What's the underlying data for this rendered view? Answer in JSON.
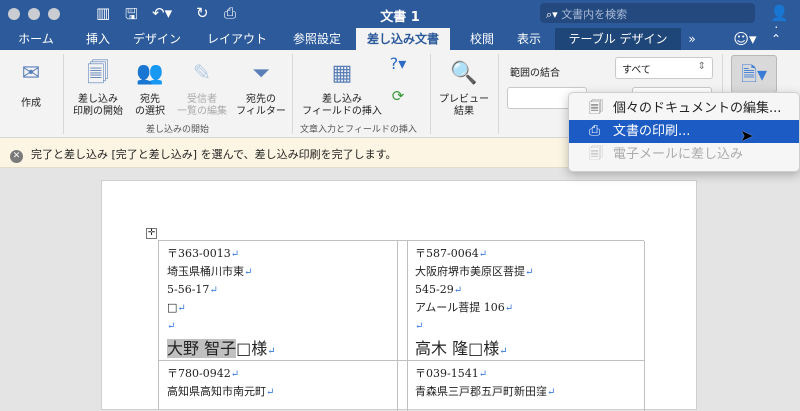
{
  "window": {
    "title": "文書 1",
    "search_placeholder": "文書内を検索"
  },
  "tabs": [
    "ホーム",
    "挿入",
    "デザイン",
    "レイアウト",
    "参照設定",
    "差し込み文書",
    "校閲",
    "表示",
    "テーブル デザイン"
  ],
  "ribbon": {
    "create": "作成",
    "start_merge": [
      "差し込み",
      "印刷の開始"
    ],
    "select_recipients": [
      "宛先",
      "の選択"
    ],
    "edit_recipients": [
      "受信者",
      "一覧の編集"
    ],
    "filter": [
      "宛先の",
      "フィルター"
    ],
    "insert_field": [
      "差し込み",
      "フィールドの挿入"
    ],
    "preview": [
      "プレビュー",
      "結果"
    ],
    "group_start": "差し込みの開始",
    "group_insert": "文章入力とフィールドの挿入",
    "range_label": "範囲の結合",
    "range_value": "すべて"
  },
  "message": {
    "text": "完了と差し込み  [完了と差し込み] を選んで、差し込み印刷を完了します。"
  },
  "menu": {
    "items": [
      {
        "label": "個々のドキュメントの編集...",
        "state": "normal"
      },
      {
        "label": "文書の印刷...",
        "state": "selected"
      },
      {
        "label": "電子メールに差し込み",
        "state": "disabled"
      }
    ]
  },
  "labels": [
    {
      "zip": "〒363-0013",
      "lines": [
        "埼玉県桶川市東",
        "5-56-17",
        "□",
        ""
      ],
      "name": "大野 智子",
      "suffix": "□様"
    },
    {
      "zip": "〒587-0064",
      "lines": [
        "大阪府堺市美原区菩提",
        "545-29",
        "アムール菩提 106",
        ""
      ],
      "name": "高木 隆",
      "suffix": "□様"
    },
    {
      "zip": "〒780-0942",
      "lines": [
        "高知県高知市南元町"
      ]
    },
    {
      "zip": "〒039-1541",
      "lines": [
        "青森県三戸郡五戸町新田窪"
      ]
    }
  ],
  "return_mark": "↵"
}
